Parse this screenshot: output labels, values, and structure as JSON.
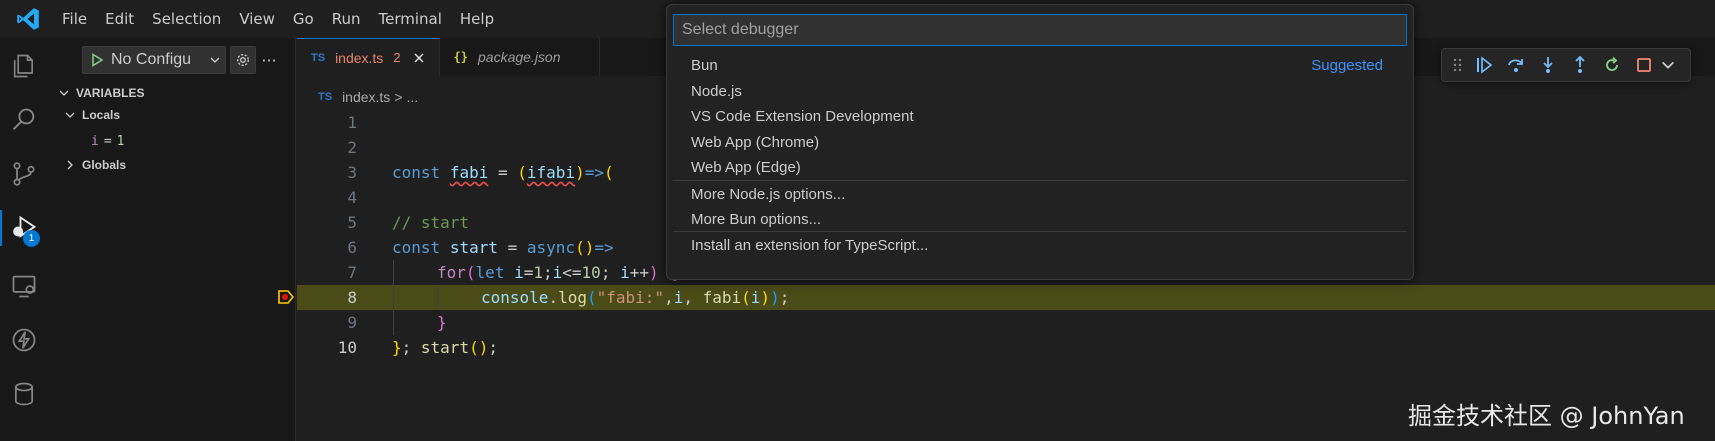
{
  "menu": {
    "items": [
      "File",
      "Edit",
      "Selection",
      "View",
      "Go",
      "Run",
      "Terminal",
      "Help"
    ]
  },
  "activity_bar": {
    "icons": [
      "explorer-icon",
      "search-icon",
      "source-control-icon",
      "run-debug-icon",
      "remote-explorer-icon",
      "lightning-icon",
      "database-icon"
    ],
    "debug_badge": "1",
    "accent": "#0078d4"
  },
  "sidebar": {
    "config_label": "No Configu",
    "more_label": "···",
    "variables_header": "VARIABLES",
    "locals_label": "Locals",
    "local_var": {
      "name": "i",
      "eq": "=",
      "value": "1"
    },
    "globals_label": "Globals"
  },
  "tabs": [
    {
      "badge": "TS",
      "label": "index.ts",
      "count": "2",
      "active": true
    },
    {
      "badge": "{}",
      "label": "package.json",
      "active": false
    }
  ],
  "breadcrumb": {
    "badge": "TS",
    "file": "index.ts",
    "sep": ">",
    "tail": "..."
  },
  "editor": {
    "line_numbers": [
      "1",
      "2",
      "3",
      "4",
      "5",
      "6",
      "7",
      "8",
      "9",
      "10"
    ],
    "current_line": 8,
    "lines": {
      "l3": {
        "kw": "const",
        "name": "fabi",
        "eq": " = ",
        "p_open": "(",
        "param": "ifabi",
        "p_close": ")",
        "arrow": "=>",
        "rest": "("
      },
      "l5": {
        "comment": "// start"
      },
      "l6": {
        "kw": "const",
        "name": "start",
        "eq": " = ",
        "async": "async",
        "p": "()",
        "arrow": "=>"
      },
      "l7": {
        "for": "for",
        "p_open": "(",
        "let": "let",
        "i": " i",
        "init": "=",
        "one": "1",
        "semi": ";",
        "i2": "i",
        "lte": "<=",
        "ten": "10",
        "semi2": "; ",
        "i3": "i",
        "inc": "++",
        "p_close": ")",
        "brace": " {"
      },
      "l8": {
        "console": "console",
        "dot": ".",
        "log": "log",
        "p_open": "(",
        "str": "\"fabi:\"",
        "comma": ",",
        "i": "i",
        "comma2": ", ",
        "fabi": "fabi",
        "p2_open": "(",
        "i2": "i",
        "p2_close": ")",
        "p_close": ")",
        "semi": ";"
      },
      "l9": {
        "brace": "}"
      },
      "l10": {
        "brace": "}",
        "semi": "; ",
        "start": "start",
        "p": "()",
        "end": ";"
      }
    }
  },
  "debug_toolbar": {
    "buttons": [
      "drag-handle-icon",
      "continue-icon",
      "step-over-icon",
      "step-into-icon",
      "step-out-icon",
      "restart-icon",
      "stop-icon",
      "chevron-down-icon"
    ]
  },
  "quick_pick": {
    "placeholder": "Select debugger",
    "items": [
      {
        "label": "Bun",
        "tag": "Suggested"
      },
      {
        "label": "Node.js"
      },
      {
        "label": "VS Code Extension Development"
      },
      {
        "label": "Web App (Chrome)"
      },
      {
        "label": "Web App (Edge)"
      },
      {
        "label": "More Node.js options..."
      },
      {
        "label": "More Bun options..."
      },
      {
        "label": "Install an extension for TypeScript..."
      }
    ]
  },
  "watermark": "掘金技术社区 @ JohnYan"
}
